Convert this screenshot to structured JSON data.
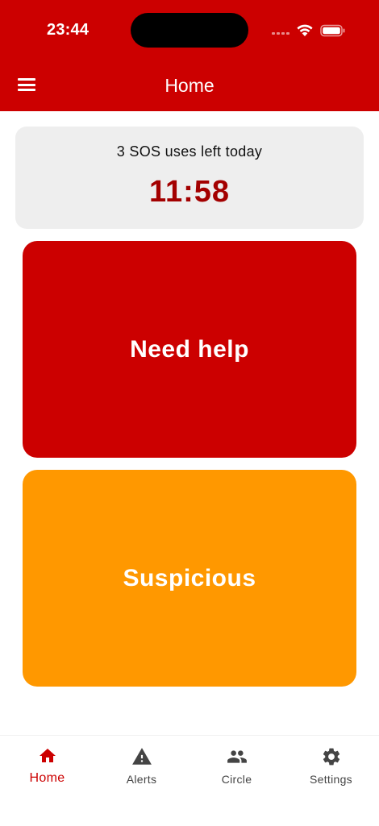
{
  "status_bar": {
    "time": "23:44"
  },
  "app_bar": {
    "title": "Home",
    "menu_icon": "hamburger-menu-icon",
    "color": "#cc0000"
  },
  "sos_card": {
    "uses_left_text": "3 SOS uses left today",
    "timer": "11:58",
    "timer_color": "#a30000"
  },
  "actions": {
    "need_help": {
      "label": "Need help",
      "color": "#cc0000"
    },
    "suspicious": {
      "label": "Suspicious",
      "color": "#ff9800"
    }
  },
  "bottom_nav": {
    "active": "Home",
    "items": [
      {
        "label": "Home",
        "icon": "home-icon"
      },
      {
        "label": "Alerts",
        "icon": "warning-icon"
      },
      {
        "label": "Circle",
        "icon": "people-icon"
      },
      {
        "label": "Settings",
        "icon": "gear-icon"
      }
    ]
  }
}
